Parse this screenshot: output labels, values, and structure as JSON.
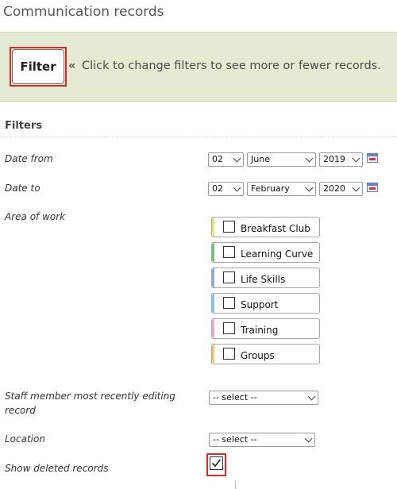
{
  "page": {
    "title": "Communication records"
  },
  "filter_bar": {
    "button_label": "Filter",
    "hint_chevron": "«",
    "hint_text": "Click to change filters to see more or fewer records."
  },
  "filters": {
    "heading": "Filters",
    "date_from": {
      "label": "Date from",
      "day": "02",
      "month": "June",
      "year": "2019"
    },
    "date_to": {
      "label": "Date to",
      "day": "02",
      "month": "February",
      "year": "2020"
    },
    "area_of_work": {
      "label": "Area of work",
      "items": [
        {
          "label": "Breakfast Club",
          "color": "#e6e66a",
          "checked": false
        },
        {
          "label": "Learning Curve",
          "color": "#6bc96b",
          "checked": false
        },
        {
          "label": "Life Skills",
          "color": "#8fa8e0",
          "checked": false
        },
        {
          "label": "Support",
          "color": "#7ec8e8",
          "checked": false
        },
        {
          "label": "Training",
          "color": "#f0a8c8",
          "checked": false
        },
        {
          "label": "Groups",
          "color": "#f0c860",
          "checked": false
        }
      ]
    },
    "staff_member": {
      "label": "Staff member most recently editing record",
      "value": "-- select --"
    },
    "location": {
      "label": "Location",
      "value": "-- select --"
    },
    "show_deleted": {
      "label": "Show deleted records",
      "checked": true
    }
  },
  "colors": {
    "highlight_red": "#d42a2a",
    "filter_bar_bg": "#e3ecd2"
  }
}
